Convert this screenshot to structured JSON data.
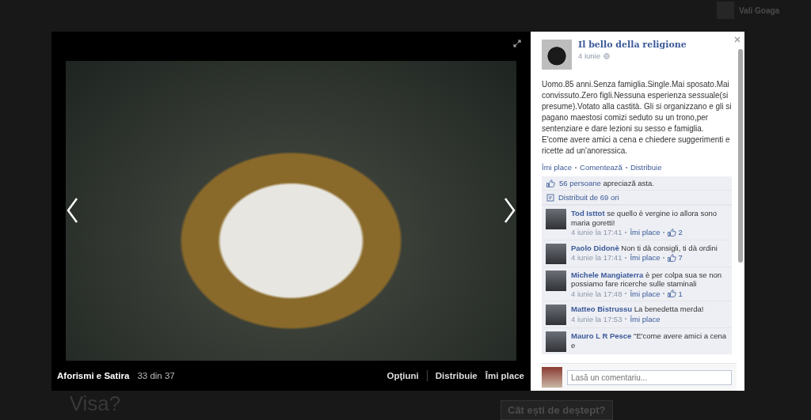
{
  "background": {
    "feed_names": [
      "Vali Goaga"
    ],
    "ad_title_lines": [
      "Visa?"
    ],
    "quiz_button": "Cât ești de deștept?"
  },
  "viewer": {
    "album": "Aforismi e Satira",
    "position": "33 din 37",
    "actions": [
      "Opţiuni",
      "Distribuie",
      "Îmi place"
    ]
  },
  "post": {
    "page_name": "Il bello della religione",
    "date": "4 iunie",
    "paragraphs": [
      "Uomo.85 anni.Senza famiglia.Single.Mai sposato.Mai convissuto.Zero figli.Nessuna esperienza sessuale(si presume).Votato alla castità. Gli si organizzano e gli si pagano maestosi comizi seduto su un trono,per sentenziare e dare lezioni su sesso e famiglia.",
      "E'come avere amici a cena e chiedere suggerimenti e ricette ad un'anoressica."
    ],
    "actions": [
      "Îmi place",
      "Comentează",
      "Distribuie"
    ],
    "likes_link": "56 persoane",
    "likes_text": "apreciază asta.",
    "shares": "Distribuit de 69 ori",
    "comments": [
      {
        "name": "Tod Isttot",
        "text": "se quello è vergine io allora sono maria goretti!",
        "time": "4 iunie la 17:41",
        "like": "Îmi place",
        "likes": "2"
      },
      {
        "name": "Paolo Didonè",
        "text": "Non ti dà consigli, ti dà ordini",
        "time": "4 iunie la 17:41",
        "like": "Îmi place",
        "likes": "7"
      },
      {
        "name": "Michele Mangiaterra",
        "text": "è per colpa sua se non possiamo fare ricerche sulle staminali",
        "time": "4 iunie la 17:48",
        "like": "Îmi place",
        "likes": "1"
      },
      {
        "name": "Matteo Bistrussu",
        "text": "La benedetta merda!",
        "time": "4 iunie la 17:53",
        "like": "Îmi place"
      },
      {
        "name": "Mauro L R Pesce",
        "text": "\"E'come avere amici a cena e"
      }
    ],
    "comment_placeholder": "Lasă un comentariu..."
  }
}
